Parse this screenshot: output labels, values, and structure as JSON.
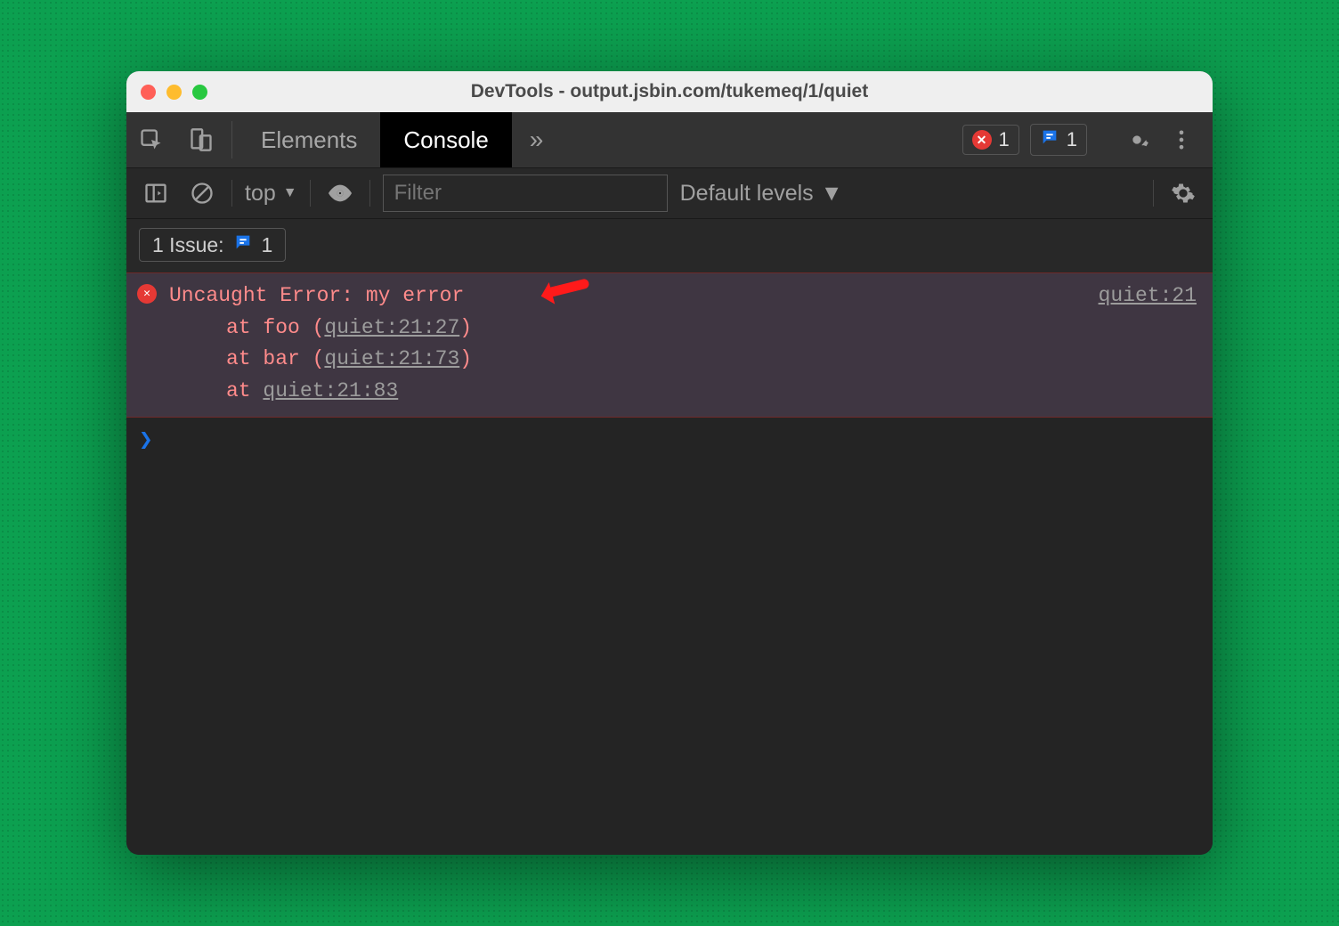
{
  "window": {
    "title": "DevTools - output.jsbin.com/tukemeq/1/quiet"
  },
  "toolbar": {
    "tabs": [
      {
        "label": "Elements",
        "active": false
      },
      {
        "label": "Console",
        "active": true
      }
    ],
    "errorBadge": {
      "count": "1"
    },
    "issueBadge": {
      "count": "1"
    }
  },
  "subbar": {
    "context": "top",
    "filterPlaceholder": "Filter",
    "levels": "Default levels"
  },
  "issues": {
    "label": "1 Issue:",
    "count": "1"
  },
  "error": {
    "message": "Uncaught Error: my error",
    "sourceLink": "quiet:21",
    "stack": [
      {
        "prefix": "at foo (",
        "link": "quiet:21:27",
        "suffix": ")"
      },
      {
        "prefix": "at bar (",
        "link": "quiet:21:73",
        "suffix": ")"
      },
      {
        "prefix": "at ",
        "link": "quiet:21:83",
        "suffix": ""
      }
    ]
  }
}
